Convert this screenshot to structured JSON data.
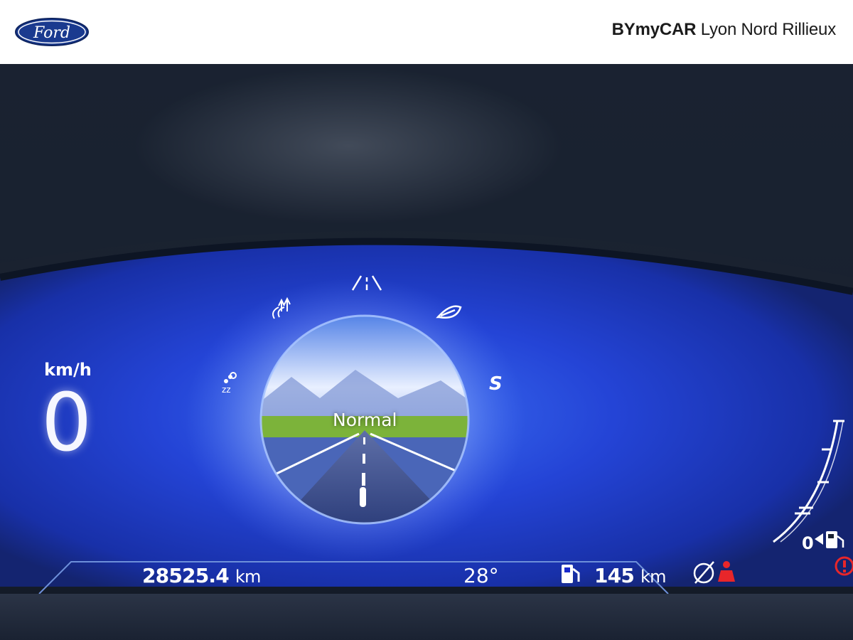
{
  "header": {
    "logo_text": "Ford",
    "dealer_brand": "BYmyCAR",
    "dealer_location": "Lyon Nord Rillieux"
  },
  "cluster": {
    "speed_unit": "km/h",
    "speed_value": "0",
    "drive_mode": "Normal",
    "odometer_value": "28525.4",
    "odometer_unit": "km",
    "temperature": "28°",
    "range_value": "145",
    "range_unit": "km",
    "fuel_level_label": "0",
    "drive_mode_icons": [
      "lane-icon",
      "eco-leaf-icon",
      "sport-icon",
      "trail-icon",
      "snow-icon"
    ]
  },
  "colors": {
    "display_blue": "#2346d8",
    "warning_red": "#e8262a",
    "background_dark": "#161e2a"
  }
}
